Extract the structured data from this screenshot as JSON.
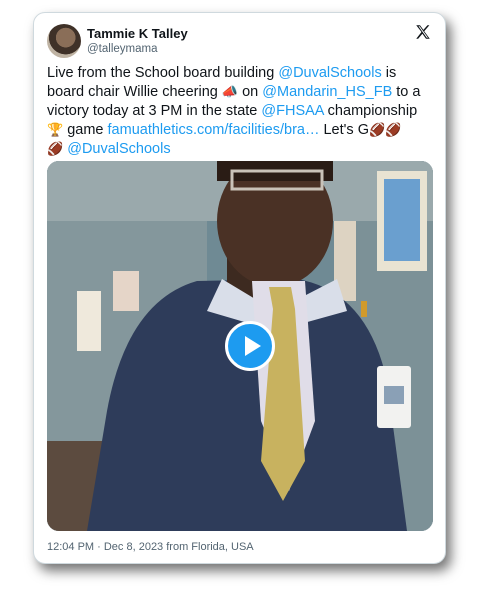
{
  "author": {
    "name": "Tammie K Talley",
    "handle": "@talleymama"
  },
  "icons": {
    "platform": "x-logo-icon",
    "avatar": "avatar-photo",
    "play": "play-icon"
  },
  "tweet": {
    "t1": "Live from the School board building ",
    "m1": "@DuvalSchools",
    "t2": " is board chair Willie cheering ",
    "e1": "📣",
    "t3": " on ",
    "m2": "@Mandarin_HS_FB",
    "t4": " to a victory today at 3 PM in the state ",
    "m3": "@FHSAA",
    "t5": " championship ",
    "e2": "🏆",
    "t6": " game ",
    "link": "famuathletics.com/facilities/bra…",
    "t7": " Let's G",
    "e3": "🏈🏈",
    "e4": "🏈",
    "t8": " ",
    "m4": "@DuvalSchools"
  },
  "meta": "12:04 PM · Dec 8, 2023 from Florida, USA",
  "colors": {
    "link": "#1d9bf0",
    "text": "#0f1419",
    "muted": "#536471",
    "border": "#cfd9de"
  }
}
